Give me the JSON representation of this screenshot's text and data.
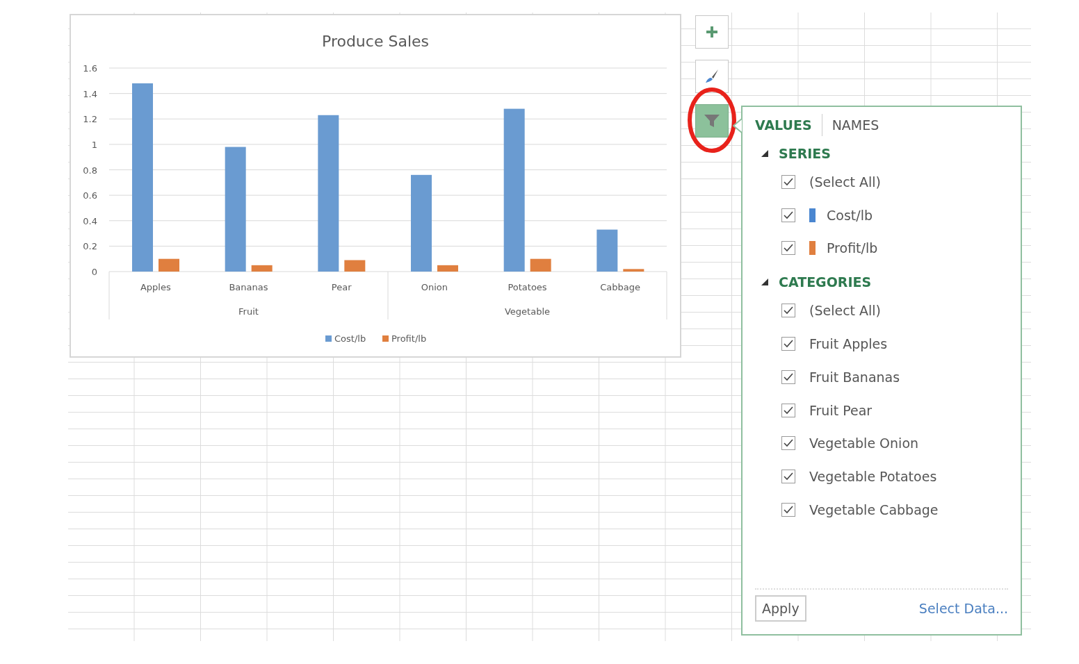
{
  "chart": {
    "chart_data": {
      "type": "bar",
      "title": "Produce Sales",
      "grid": true,
      "legend": "bottom",
      "categories": [
        "Apples",
        "Bananas",
        "Pear",
        "Onion",
        "Potatoes",
        "Cabbage"
      ],
      "series": [
        {
          "name": "Cost/lb",
          "color": "#6a9bd1",
          "values": [
            1.48,
            0.98,
            1.23,
            0.76,
            1.28,
            0.33
          ]
        },
        {
          "name": "Profit/lb",
          "color": "#e07f3f",
          "values": [
            0.1,
            0.05,
            0.09,
            0.05,
            0.1,
            0.02
          ]
        }
      ],
      "ylim": [
        0,
        1.6
      ],
      "yticks": [
        {
          "value": 0,
          "label": "0"
        },
        {
          "value": 0.2,
          "label": "0.2"
        },
        {
          "value": 0.4,
          "label": "0.4"
        },
        {
          "value": 0.6,
          "label": "0.6"
        },
        {
          "value": 0.8,
          "label": "0.8"
        },
        {
          "value": 1,
          "label": "1"
        },
        {
          "value": 1.2,
          "label": "1.2"
        },
        {
          "value": 1.4,
          "label": "1.4"
        },
        {
          "value": 1.6,
          "label": "1.6"
        }
      ]
    },
    "category_groups": [
      "Fruit",
      "Vegetable"
    ]
  },
  "side_buttons": [
    {
      "kind": "add",
      "selected": false
    },
    {
      "kind": "style",
      "selected": false
    },
    {
      "kind": "filter",
      "selected": true
    }
  ],
  "filter_panel": {
    "tabs": [
      {
        "label": "VALUES",
        "selected": true
      },
      {
        "label": "NAMES",
        "selected": false
      }
    ],
    "sections": [
      {
        "title": "SERIES",
        "expanded": true,
        "items": [
          {
            "label": "(Select All)",
            "checked": true
          },
          {
            "label": "Cost/lb",
            "checked": true,
            "color": "#4a86d0"
          },
          {
            "label": "Profit/lb",
            "checked": true,
            "color": "#e07f3f"
          }
        ]
      },
      {
        "title": "CATEGORIES",
        "expanded": true,
        "items": [
          {
            "label": "(Select All)",
            "checked": true
          },
          {
            "label": "Fruit Apples",
            "checked": true
          },
          {
            "label": "Fruit Bananas",
            "checked": true
          },
          {
            "label": "Fruit Pear",
            "checked": true
          },
          {
            "label": "Vegetable Onion",
            "checked": true
          },
          {
            "label": "Vegetable Potatoes",
            "checked": true
          },
          {
            "label": "Vegetable Cabbage",
            "checked": true
          }
        ]
      }
    ],
    "apply_button": "Apply",
    "select_data_link": "Select Data..."
  }
}
